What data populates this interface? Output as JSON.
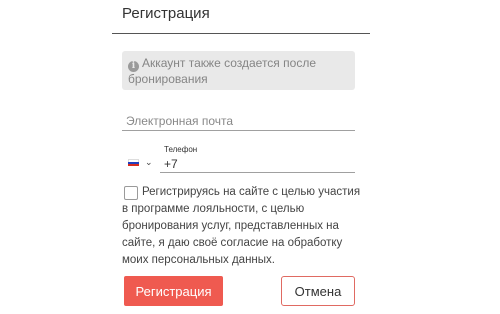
{
  "header": {
    "title": "Регистрация"
  },
  "info": {
    "icon": "info-icon",
    "icon_glyph": "i",
    "text": "Аккаунт также создается после бронирования"
  },
  "email": {
    "placeholder": "Электронная почта",
    "value": ""
  },
  "phone": {
    "label": "Телефон",
    "value": "+7",
    "country_flag": "russia-flag-icon",
    "chevron_icon": "chevron-down-icon"
  },
  "consent": {
    "checked": false,
    "text": "Регистрируясь на сайте с целью участия в программе лояльности, с целью бронирования услуг, представленных на сайте, я даю своё согласие на обработку моих персональных данных."
  },
  "buttons": {
    "register_label": "Регистрация",
    "cancel_label": "Отмена"
  },
  "colors": {
    "accent": "#ef5a50",
    "info_background": "#e9e9e9",
    "cancel_border": "#e06a62"
  }
}
